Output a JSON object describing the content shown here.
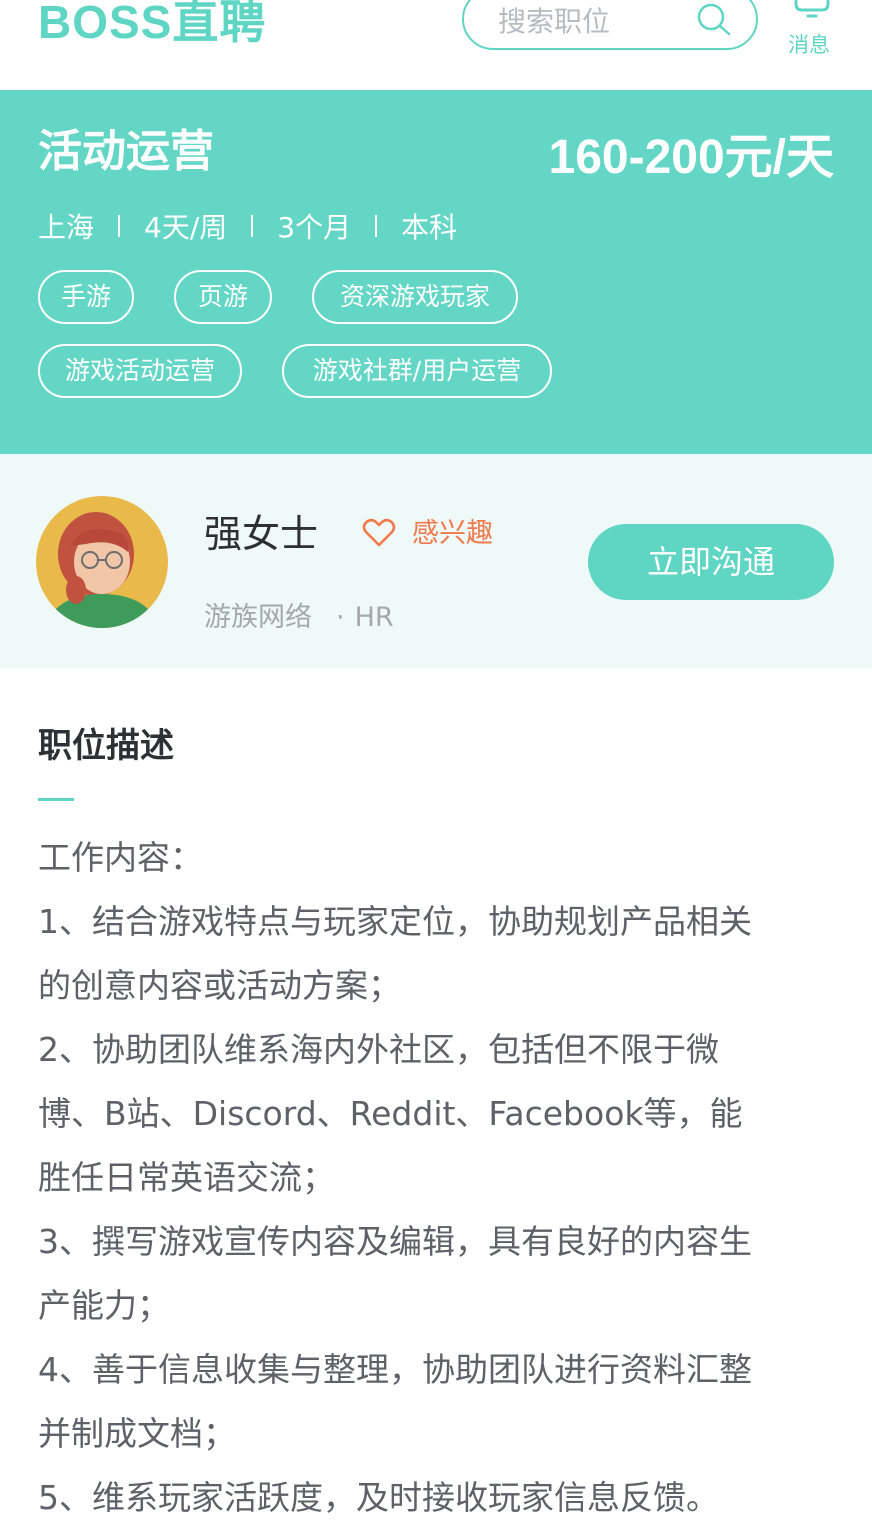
{
  "header": {
    "logo": "BOSS直聘",
    "search_placeholder": "搜索职位",
    "message_label": "消息"
  },
  "job": {
    "title": "活动运营",
    "salary": "160-200元/天",
    "location": "上海",
    "days_per_week": "4天/周",
    "duration": "3个月",
    "education": "本科",
    "tags": [
      "手游",
      "页游",
      "资深游戏玩家",
      "游戏活动运营",
      "游戏社群/用户运营"
    ]
  },
  "recruiter": {
    "name": "强女士",
    "interest_label": "感兴趣",
    "company": "游族网络",
    "role": "HR",
    "chat_button": "立即沟通"
  },
  "description": {
    "title": "职位描述",
    "lines": [
      "工作内容：",
      "1、结合游戏特点与玩家定位，协助规划产品相关",
      "的创意内容或活动方案；",
      "2、协助团队维系海内外社区，包括但不限于微",
      "博、B站、Discord、Reddit、Facebook等，能",
      "胜任日常英语交流；",
      "3、撰写游戏宣传内容及编辑，具有良好的内容生",
      "产能力；",
      "4、善于信息收集与整理，协助团队进行资料汇整",
      "并制成文档；",
      "5、维系玩家活跃度，及时接收玩家信息反馈。"
    ]
  },
  "colors": {
    "brand": "#5fd5c3",
    "banner": "#64d6c6",
    "recruiter_bg": "#eff9f7",
    "interest": "#f07a4b"
  }
}
